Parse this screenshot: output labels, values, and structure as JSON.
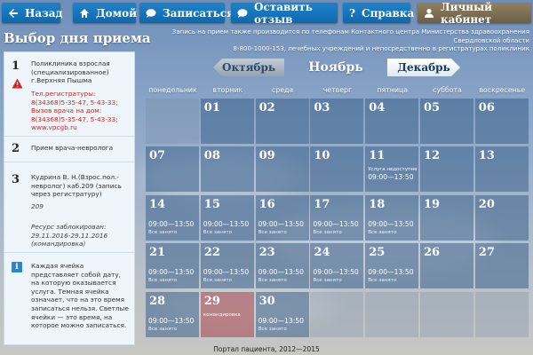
{
  "nav": {
    "back": "Назад",
    "home": "Домой",
    "signup": "Записаться",
    "review": "Оставить отзыв",
    "help": "Справка",
    "cabinet": "Личный кабинет"
  },
  "header": {
    "title": "Выбор дня приема",
    "contact_line1": "Запись на прием также производится по телефонам Контактного центра Министерства здравоохранения Свердловской области",
    "contact_line2": "8-800-1000-153, лечебных учреждений и непосредственно в регистратурах поликлиник"
  },
  "steps": {
    "s1": {
      "num": "1",
      "name": "Поликлиника взрослая (специализированное) г.Верхняя Пышма",
      "phones": "Тел.регистратуры: 8(34368)5-35-47, 5-43-33; Вызов врача на дом: 8(34368)5-35-47, 5-43-33; www.vpcgb.ru"
    },
    "s2": {
      "num": "2",
      "text": "Прием врача-невролога"
    },
    "s3": {
      "num": "3",
      "doctor": "Кудрина В. Н.(Взрос.пол.- невролог) каб.209 (запись через регистратуру)",
      "room": "209",
      "blocked": "Ресурс заблокирован: 29.11.2016-29.11.2016 (командировка)"
    },
    "info": {
      "icon": "i",
      "text": "Каждая ячейка представляет собой дату, на которую оказывается услуга. Темная ячейка означает, что на это время записаться нельзя. Светлые ячейки — это время, на которое можно записаться."
    }
  },
  "calendar": {
    "prev_month": "Октябрь",
    "current_month": "Ноябрь",
    "next_month": "Декабрь",
    "weekdays": [
      "понедельник",
      "вторник",
      "среда",
      "четверг",
      "пятница",
      "суббота",
      "воскресенье"
    ],
    "weeks": [
      [
        {
          "day": ""
        },
        {
          "day": "01"
        },
        {
          "day": "02"
        },
        {
          "day": "03"
        },
        {
          "day": "04"
        },
        {
          "day": "05"
        },
        {
          "day": "06"
        }
      ],
      [
        {
          "day": "07"
        },
        {
          "day": "08"
        },
        {
          "day": "09"
        },
        {
          "day": "10"
        },
        {
          "day": "11",
          "note": "Услуга недоступна",
          "time": "09:00—13:50"
        },
        {
          "day": "12"
        },
        {
          "day": "13"
        }
      ],
      [
        {
          "day": "14",
          "time": "09:00—13:50",
          "busy": "Все занято"
        },
        {
          "day": "15",
          "time": "09:00—13:50",
          "busy": "Все занято"
        },
        {
          "day": "16",
          "time": "09:00—13:50",
          "busy": "Все занято"
        },
        {
          "day": "17",
          "time": "09:00—13:50",
          "busy": "Все занято"
        },
        {
          "day": "18",
          "time": "09:00—13:50",
          "busy": "Все занято"
        },
        {
          "day": "19"
        },
        {
          "day": "20"
        }
      ],
      [
        {
          "day": "21",
          "time": "09:00—13:50",
          "busy": "Все занято"
        },
        {
          "day": "22",
          "time": "09:00—13:50",
          "busy": "Все занято"
        },
        {
          "day": "23",
          "time": "09:00—13:50",
          "busy": "Все занято"
        },
        {
          "day": "24",
          "time": "09:00—13:50",
          "busy": "Все занято"
        },
        {
          "day": "25",
          "time": "09:00—13:50",
          "busy": "Все занято"
        },
        {
          "day": "26"
        },
        {
          "day": "27"
        }
      ],
      [
        {
          "day": "28",
          "time": "09:00—13:50",
          "busy": "Все занято"
        },
        {
          "day": "29",
          "note": "командировка",
          "state": "disabled"
        },
        {
          "day": "30",
          "time": "09:00—13:50",
          "busy": "Все занято"
        },
        {
          "day": ""
        },
        {
          "day": ""
        },
        {
          "day": ""
        },
        {
          "day": ""
        }
      ]
    ]
  },
  "footer": "Портал пациента, 2012—2015",
  "colors": {
    "nav_blue": "#1178bf",
    "cabinet_brown": "#7d6f52",
    "cell_dark": "#3a608c",
    "cell_disabled": "#aa505a",
    "alert_red": "#d3261f"
  }
}
